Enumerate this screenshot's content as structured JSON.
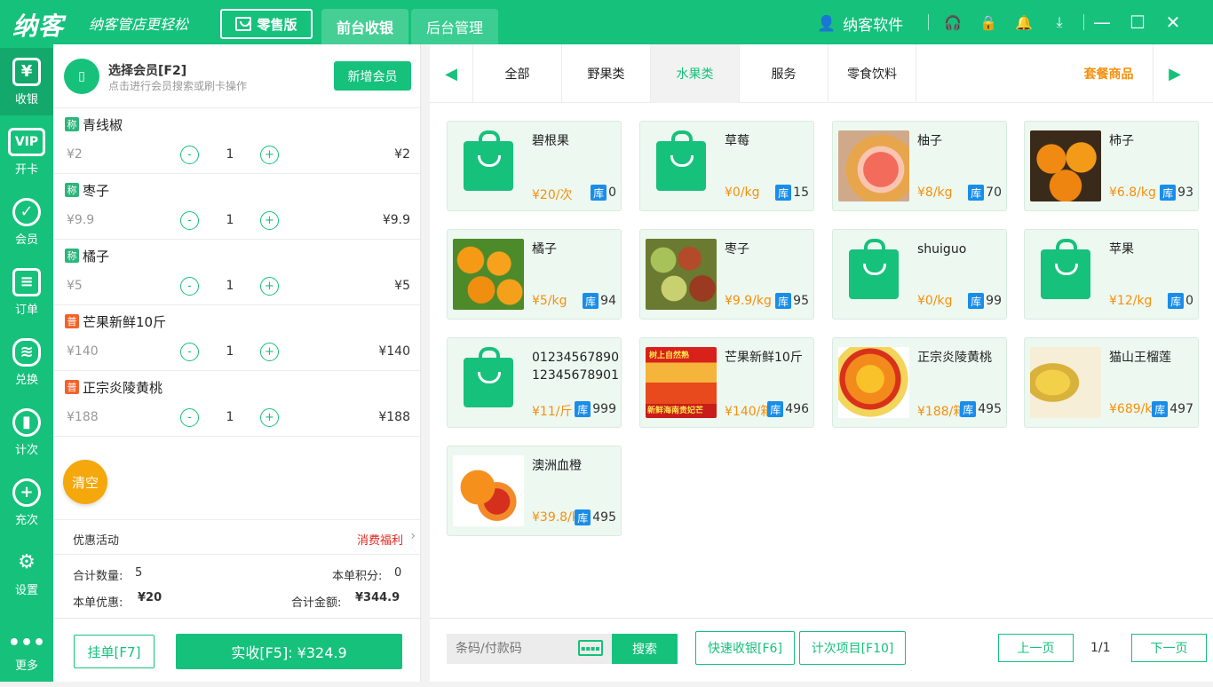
{
  "header": {
    "logo": "纳客",
    "slogan": "纳客管店更轻松",
    "edition": "零售版",
    "tabs": [
      "前台收银",
      "后台管理"
    ],
    "user": "纳客软件"
  },
  "sidebar": [
    {
      "label": "收银",
      "icon": "cashier-icon"
    },
    {
      "label": "开卡",
      "icon": "vip-icon"
    },
    {
      "label": "会员",
      "icon": "member-icon"
    },
    {
      "label": "订单",
      "icon": "order-icon"
    },
    {
      "label": "兑换",
      "icon": "exchange-icon"
    },
    {
      "label": "计次",
      "icon": "count-icon"
    },
    {
      "label": "充次",
      "icon": "recharge-icon"
    },
    {
      "label": "设置",
      "icon": "settings-icon"
    },
    {
      "label": "更多",
      "icon": "more-icon"
    }
  ],
  "member": {
    "title": "选择会员[F2]",
    "subtitle": "点击进行会员搜索或刷卡操作",
    "add_button": "新增会员"
  },
  "cart": [
    {
      "tag": "称",
      "name": "青线椒",
      "price": "¥2",
      "qty": "1",
      "total": "¥2"
    },
    {
      "tag": "称",
      "name": "枣子",
      "price": "¥9.9",
      "qty": "1",
      "total": "¥9.9"
    },
    {
      "tag": "称",
      "name": "橘子",
      "price": "¥5",
      "qty": "1",
      "total": "¥5"
    },
    {
      "tag": "普",
      "name": "芒果新鲜10斤",
      "price": "¥140",
      "qty": "1",
      "total": "¥140"
    },
    {
      "tag": "普",
      "name": "正宗炎陵黄桃",
      "price": "¥188",
      "qty": "1",
      "total": "¥188"
    }
  ],
  "cart_controls": {
    "minus": "-",
    "plus": "+",
    "clear": "清空"
  },
  "promo": {
    "label": "优惠活动",
    "link": "消费福利"
  },
  "summary": {
    "qty_label": "合计数量:",
    "qty": "5",
    "points_label": "本单积分:",
    "points": "0",
    "discount_label": "本单优惠:",
    "discount": "¥20",
    "total_label": "合计金额:",
    "total": "¥344.9"
  },
  "actions": {
    "hold": "挂单[F7]",
    "pay": "实收[F5]: ¥324.9"
  },
  "categories": [
    "全部",
    "野果类",
    "水果类",
    "服务",
    "零食饮料"
  ],
  "combo": "套餐商品",
  "stock_tag": "库",
  "products": [
    {
      "name": "碧根果",
      "price": "¥20/次",
      "stock": "0",
      "img": "bag"
    },
    {
      "name": "草莓",
      "price": "¥0/kg",
      "stock": "15",
      "img": "bag"
    },
    {
      "name": "柚子",
      "price": "¥8/kg",
      "stock": "70",
      "img": "grapefruit"
    },
    {
      "name": "柿子",
      "price": "¥6.8/kg",
      "stock": "93",
      "img": "persimmon"
    },
    {
      "name": "橘子",
      "price": "¥5/kg",
      "stock": "94",
      "img": "orange"
    },
    {
      "name": "枣子",
      "price": "¥9.9/kg",
      "stock": "95",
      "img": "jujube"
    },
    {
      "name": "shuiguo",
      "price": "¥0/kg",
      "stock": "99",
      "img": "bag"
    },
    {
      "name": "苹果",
      "price": "¥12/kg",
      "stock": "0",
      "img": "bag"
    },
    {
      "name": "0123456789012345678901",
      "price": "¥11/斤",
      "stock": "999",
      "img": "bag"
    },
    {
      "name": "芒果新鲜10斤",
      "price": "¥140/箱",
      "stock": "496",
      "img": "mango"
    },
    {
      "name": "正宗炎陵黄桃",
      "price": "¥188/箱",
      "stock": "495",
      "img": "peach"
    },
    {
      "name": "猫山王榴莲",
      "price": "¥689/kg",
      "stock": "497",
      "img": "durian"
    },
    {
      "name": "澳洲血橙",
      "price": "¥39.8/kg",
      "stock": "495",
      "img": "bloodorange"
    }
  ],
  "mango_banner": {
    "top": "树上自然熟",
    "bottom": "新鲜海南贵妃芒"
  },
  "footer": {
    "barcode_placeholder": "条码/付款码",
    "search": "搜索",
    "quick_pay": "快速收银[F6]",
    "count_items": "计次项目[F10]",
    "prev": "上一页",
    "page": "1/1",
    "next": "下一页"
  },
  "colors": {
    "primary": "#16c17c",
    "price": "#f5900c",
    "danger": "#e0251d",
    "stock": "#1a8de8"
  }
}
